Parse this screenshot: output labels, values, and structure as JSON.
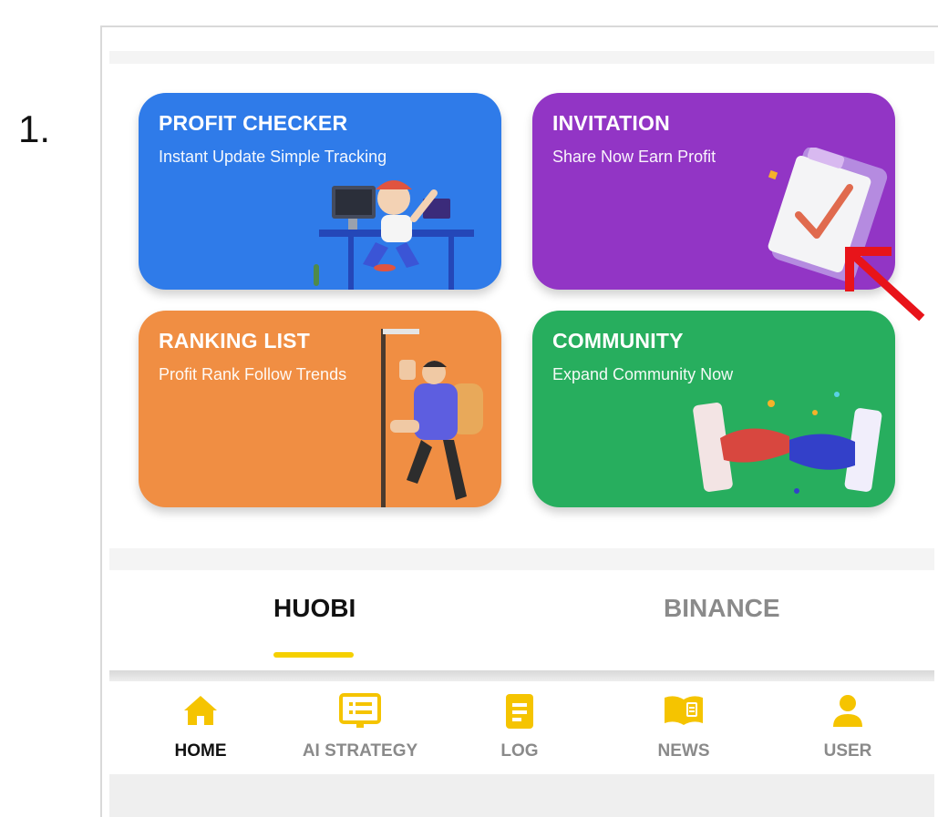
{
  "step_number": "1.",
  "cards": [
    {
      "id": "profit",
      "title": "PROFIT CHECKER",
      "subtitle": "Instant Update Simple Tracking",
      "color": "#2f7be9"
    },
    {
      "id": "invite",
      "title": "INVITATION",
      "subtitle": "Share Now Earn Profit",
      "color": "#9235c5"
    },
    {
      "id": "ranking",
      "title": "RANKING LIST",
      "subtitle": "Profit Rank Follow Trends",
      "color": "#f08e43"
    },
    {
      "id": "community",
      "title": "COMMUNITY",
      "subtitle": "Expand Community Now",
      "color": "#27ae5e"
    }
  ],
  "exchange_tabs": {
    "active": "HUOBI",
    "items": [
      "HUOBI",
      "BINANCE"
    ],
    "underline_color": "#f5d000"
  },
  "bottom_nav": {
    "active": "HOME",
    "items": [
      {
        "label": "HOME",
        "icon": "home-icon"
      },
      {
        "label": "AI STRATEGY",
        "icon": "monitor-icon"
      },
      {
        "label": "LOG",
        "icon": "document-icon"
      },
      {
        "label": "NEWS",
        "icon": "book-icon"
      },
      {
        "label": "USER",
        "icon": "user-icon"
      }
    ],
    "icon_color": "#f5c400"
  },
  "annotation": {
    "arrow_color": "#e8141a",
    "arrow_icon": "arrow-pointer-icon"
  }
}
